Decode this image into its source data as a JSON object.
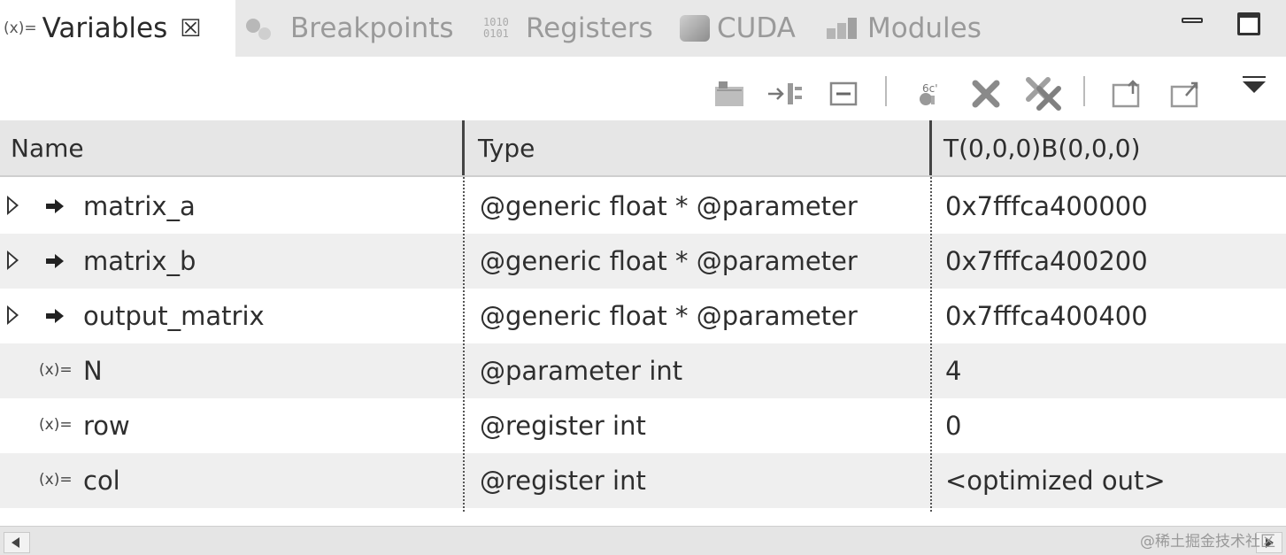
{
  "tabs": [
    {
      "label": "Variables",
      "icon": "variables-icon",
      "active": true,
      "close": "☒"
    },
    {
      "label": "Breakpoints",
      "icon": "breakpoints-icon",
      "active": false
    },
    {
      "label": "Registers",
      "icon": "registers-icon",
      "active": false,
      "icon_text": "1010\n0101"
    },
    {
      "label": "CUDA",
      "icon": "cuda-icon",
      "active": false
    },
    {
      "label": "Modules",
      "icon": "modules-icon",
      "active": false
    }
  ],
  "var_icon_text": "(x)=",
  "toolbar": {
    "icons": [
      "collapse-all-icon",
      "show-type-names-icon",
      "collapse-icon",
      "watch-expression-icon",
      "remove-icon",
      "remove-all-icon",
      "export-icon",
      "import-icon",
      "view-menu-icon"
    ]
  },
  "table": {
    "columns": [
      "Name",
      "Type",
      "T(0,0,0)B(0,0,0)"
    ],
    "rows": [
      {
        "name": "matrix_a",
        "type": "@generic float * @parameter",
        "value": "0x7fffca400000",
        "expandable": true,
        "icon": "pointer-arrow-icon"
      },
      {
        "name": "matrix_b",
        "type": "@generic float * @parameter",
        "value": "0x7fffca400200",
        "expandable": true,
        "icon": "pointer-arrow-icon"
      },
      {
        "name": "output_matrix",
        "type": "@generic float * @parameter",
        "value": "0x7fffca400400",
        "expandable": true,
        "icon": "pointer-arrow-icon"
      },
      {
        "name": "N",
        "type": "@parameter int",
        "value": "4",
        "expandable": false,
        "icon": "variable-icon"
      },
      {
        "name": "row",
        "type": "@register int",
        "value": "0",
        "expandable": false,
        "icon": "variable-icon"
      },
      {
        "name": "col",
        "type": "@register int",
        "value": "<optimized out>",
        "expandable": false,
        "icon": "variable-icon"
      }
    ]
  },
  "watermark": "@稀土掘金技术社区",
  "colors": {
    "tab_bar_bg": "#e8e8e8",
    "header_bg": "#e6e6e6",
    "alt_row_bg": "#efefef",
    "inactive_text": "#9a9a9a"
  }
}
